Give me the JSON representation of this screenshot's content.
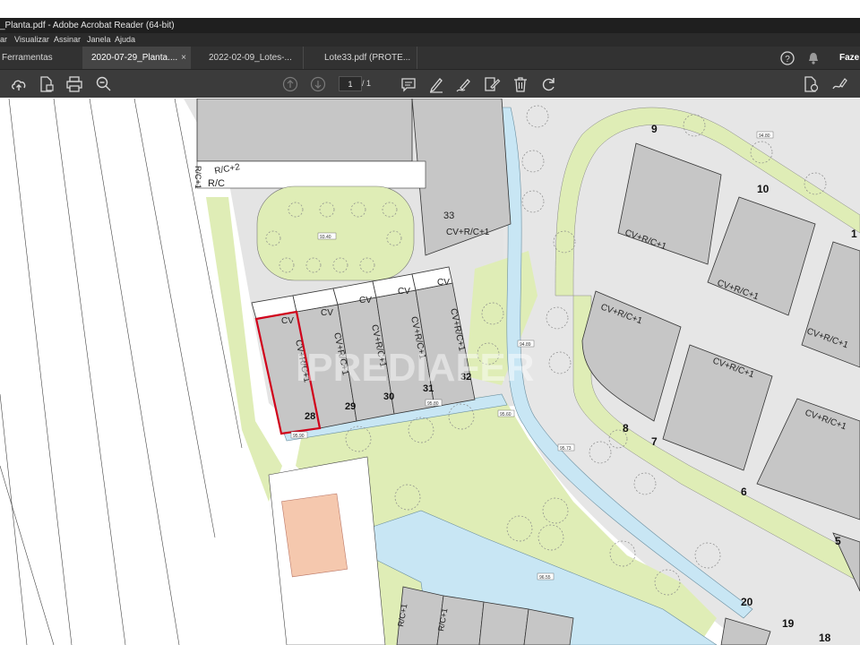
{
  "window": {
    "title": "_Planta.pdf - Adobe Acrobat Reader (64-bit)"
  },
  "menu": [
    "ar",
    "Visualizar",
    "Assinar",
    "Janela",
    "Ajuda"
  ],
  "tabs": [
    {
      "label": "Ferramentas",
      "active": false
    },
    {
      "label": "2020-07-29_Planta....",
      "active": true
    },
    {
      "label": "2022-02-09_Lotes-...",
      "active": false
    },
    {
      "label": "Lote33.pdf (PROTE...",
      "active": false
    }
  ],
  "tab_close": "×",
  "header_right": {
    "label": "Faze"
  },
  "toolbar": {
    "page_current": "1",
    "page_total": "/ 1"
  },
  "colors": {
    "titlebar": "#1f1f1f",
    "toolbar": "#3b3b3b",
    "lot_fill": "#c6c6c6",
    "green": "#dfedb6",
    "water": "#c8e6f4",
    "highlight": "#d0021b"
  },
  "plan": {
    "lots": {
      "l28": "28",
      "l29": "29",
      "l30": "30",
      "l31": "31",
      "l32": "32",
      "l33": "33",
      "l5": "5",
      "l6": "6",
      "l7": "7",
      "l8": "8",
      "l9": "9",
      "l10": "10",
      "l20": "20",
      "l19": "19",
      "l18": "18",
      "l1": "1"
    },
    "labels": {
      "rc1": "R/C+1",
      "rc2": "R/C+2",
      "rc": "R/C",
      "cv": "CV",
      "cvrc1": "CV+R/C+1"
    },
    "elevations": [
      "93.40",
      "94.80",
      "95.80",
      "95.60",
      "95.73",
      "94.89",
      "95.90",
      "96.55"
    ],
    "watermark": "IPREDIAFER"
  }
}
